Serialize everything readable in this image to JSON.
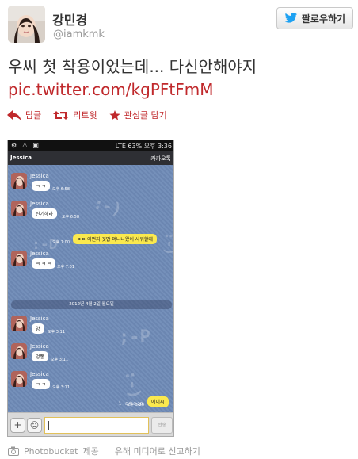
{
  "user": {
    "display_name": "강민경",
    "handle": "@iamkmk"
  },
  "follow_button": {
    "label": "팔로우하기"
  },
  "tweet": {
    "text": "우씨 첫 착용이었는데... 다신안해야지",
    "link": "pic.twitter.com/kgPFtFmM"
  },
  "actions": {
    "reply": "답글",
    "retweet": "리트윗",
    "favorite": "관심글 담기"
  },
  "phone": {
    "status_right": "LTE 63% 오후 3:36",
    "chat_title": "Jessica",
    "app_name": "카카오톡",
    "messages": [
      {
        "sender": "Jessica",
        "text": "ㅋ ㅋ",
        "time": "오후 6:58"
      },
      {
        "sender": "Jessica",
        "text": "신기해라",
        "time": "오후 6:58"
      },
      {
        "text": "ㅍㅍ 어쩐지 것밥 머니나왔어 사워할때",
        "time": "오후 7:00"
      },
      {
        "sender": "Jessica",
        "text": "ㅋ ㅋ ㅋ",
        "time": "오후 7:01"
      },
      {
        "date": "2012년 4월 2일 월요일"
      },
      {
        "sender": "Jessica",
        "text": "양",
        "time": "오후 3:11"
      },
      {
        "sender": "Jessica",
        "text": "엉뽕",
        "time": "오후 3:11"
      },
      {
        "sender": "Jessica",
        "text": "ㅋ ㅋ",
        "time": "오후 3:11"
      },
      {
        "text": "ㅋ ㅋ",
        "time": "오후 3:20",
        "count": "1"
      },
      {
        "text": "에이씨",
        "time": "오후 3:20",
        "count": "1"
      }
    ],
    "send_label": "전송"
  },
  "footer": {
    "provider": "Photobucket",
    "provided": "제공",
    "report": "유해 미디어로 신고하기"
  },
  "colors": {
    "link": "#c0292c",
    "twitter_bird": "#1da1f2",
    "chat_bg": "#6f8ab6",
    "bubble_out": "#fbe94e"
  }
}
